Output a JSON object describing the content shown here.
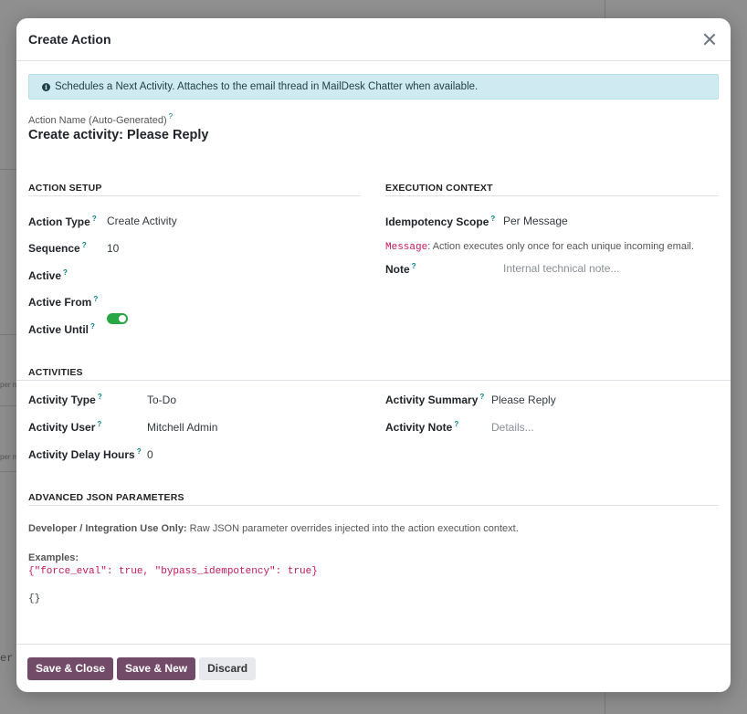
{
  "modal": {
    "title": "Create Action",
    "alert": "Schedules a Next Activity. Attaches to the email thread in MailDesk Chatter when available.",
    "action_name_label": "Action Name (Auto-Generated)",
    "question_mark": "?",
    "action_name_value": "Create activity: Please Reply"
  },
  "action_setup": {
    "title": "ACTION SETUP",
    "fields": [
      {
        "label": "Action Type",
        "value": "Create Activity"
      },
      {
        "label": "Sequence",
        "value": "10"
      },
      {
        "label": "Active",
        "value": true
      },
      {
        "label": "Active From",
        "value": ""
      },
      {
        "label": "Active Until",
        "value": ""
      }
    ]
  },
  "execution_context": {
    "title": "EXECUTION CONTEXT",
    "idempotency_label": "Idempotency Scope",
    "idempotency_value": "Per Message",
    "hint_code": "Message",
    "hint_text": ": Action executes only once for each unique incoming email.",
    "note_label": "Note",
    "note_placeholder": "Internal technical note..."
  },
  "activities": {
    "title": "ACTIVITIES",
    "activity_type_label": "Activity Type",
    "activity_type_value": "To-Do",
    "activity_user_label": "Activity User",
    "activity_user_value": "Mitchell Admin",
    "delay_label": "Activity Delay Hours",
    "delay_value": "0",
    "summary_label": "Activity Summary",
    "summary_value": "Please Reply",
    "note_label": "Activity Note",
    "note_placeholder": "Details..."
  },
  "advanced": {
    "title": "ADVANCED JSON PARAMETERS",
    "dev_label": "Developer / Integration Use Only:",
    "dev_text": " Raw JSON parameter overrides injected into the action execution context.",
    "examples_label": "Examples:",
    "example_code": "{\"force_eval\": true, \"bypass_idempotency\": true}",
    "json_value": "{}"
  },
  "footer": {
    "save_close": "Save & Close",
    "save_new": "Save & New",
    "discard": "Discard"
  },
  "background": {
    "stub_text": "per m",
    "mono_text": "er"
  },
  "colors": {
    "primary": "#714b67",
    "toggle_on": "#28a745",
    "alert_bg": "#cfeaf0",
    "code_pink": "#c2185b"
  }
}
